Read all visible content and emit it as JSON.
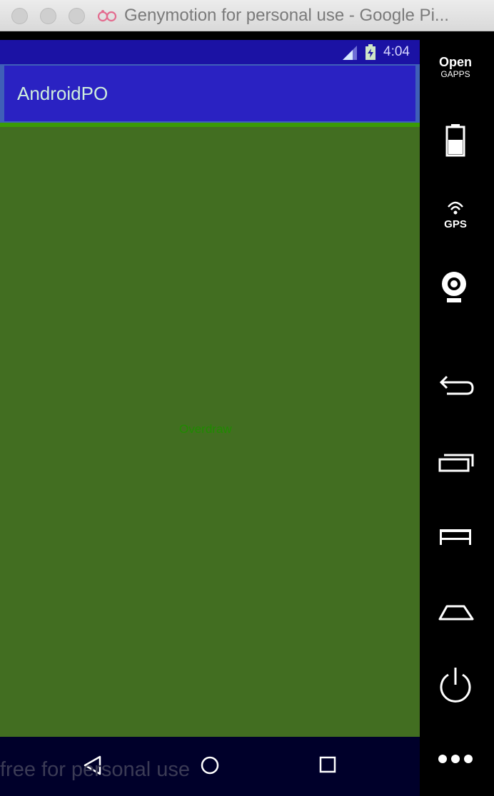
{
  "window": {
    "title": "Genymotion for personal use - Google Pi..."
  },
  "status_bar": {
    "time": "4:04",
    "icons": [
      "signal-icon",
      "battery-charging-icon"
    ]
  },
  "app": {
    "title": "AndroidPO",
    "center_text": "Overdraw"
  },
  "nav_bar": {
    "buttons": [
      "back-icon",
      "home-icon",
      "recents-icon"
    ]
  },
  "watermark": "free for personal use",
  "side_panel": {
    "opengapps_main": "Open",
    "opengapps_sub": "GAPPS",
    "gps_label": "GPS",
    "buttons": [
      "opengapps-icon",
      "battery-icon",
      "gps-icon",
      "camera-icon",
      "back-icon",
      "recent-apps-icon",
      "menu-icon",
      "home-icon",
      "power-icon",
      "more-icon"
    ]
  },
  "colors": {
    "status_bar": "#1b12a4",
    "toolbar": "#2a22c2",
    "content": "#426e21",
    "accent_line": "#3a9a06",
    "nav_bar": "#00002a"
  }
}
